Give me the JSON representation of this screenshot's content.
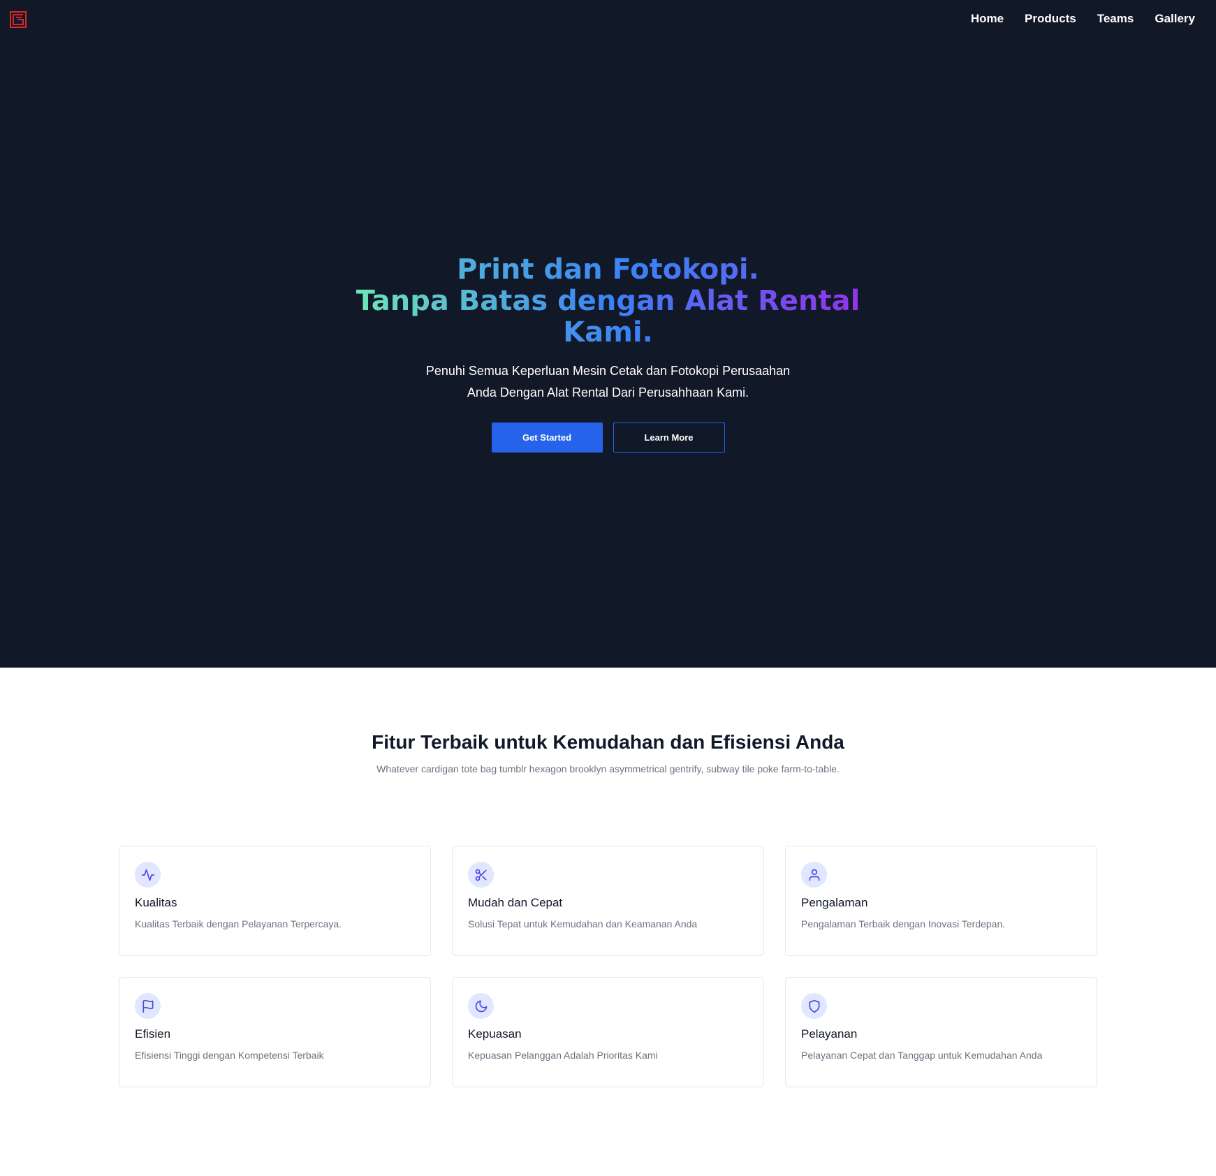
{
  "colors": {
    "hero_background": "#111827",
    "accent": "#2563eb",
    "gradient": [
      "#6ee7b7",
      "#3b82f6",
      "#9333ea"
    ],
    "logo": "#dc2626",
    "icon_background": "#e0e7ff",
    "icon_stroke": "#4f46e5"
  },
  "nav": {
    "logo_icon": "brand-logo-icon",
    "links": [
      "Home",
      "Products",
      "Teams",
      "Gallery"
    ]
  },
  "hero": {
    "title_line1": "Print dan Fotokopi.",
    "title_line2": "Tanpa Batas dengan Alat Rental",
    "title_line3": "Kami.",
    "subtitle_line1": "Penuhi Semua Keperluan Mesin Cetak dan Fotokopi Perusaahan",
    "subtitle_line2": "Anda Dengan Alat Rental Dari Perusahhaan Kami.",
    "primary_button": "Get Started",
    "secondary_button": "Learn More"
  },
  "features": {
    "title": "Fitur Terbaik untuk Kemudahan dan Efisiensi Anda",
    "description": "Whatever cardigan tote bag tumblr hexagon brooklyn asymmetrical gentrify, subway tile poke farm-to-table.",
    "items": [
      {
        "icon": "activity-icon",
        "title": "Kualitas",
        "text": "Kualitas Terbaik dengan Pelayanan Terpercaya."
      },
      {
        "icon": "scissors-icon",
        "title": "Mudah dan Cepat",
        "text": "Solusi Tepat untuk Kemudahan dan Keamanan Anda"
      },
      {
        "icon": "user-icon",
        "title": "Pengalaman",
        "text": "Pengalaman Terbaik dengan Inovasi Terdepan."
      },
      {
        "icon": "flag-icon",
        "title": "Efisien",
        "text": "Efisiensi Tinggi dengan Kompetensi Terbaik"
      },
      {
        "icon": "moon-icon",
        "title": "Kepuasan",
        "text": "Kepuasan Pelanggan Adalah Prioritas Kami"
      },
      {
        "icon": "shield-icon",
        "title": "Pelayanan",
        "text": "Pelayanan Cepat dan Tanggap untuk Kemudahan Anda"
      }
    ]
  }
}
